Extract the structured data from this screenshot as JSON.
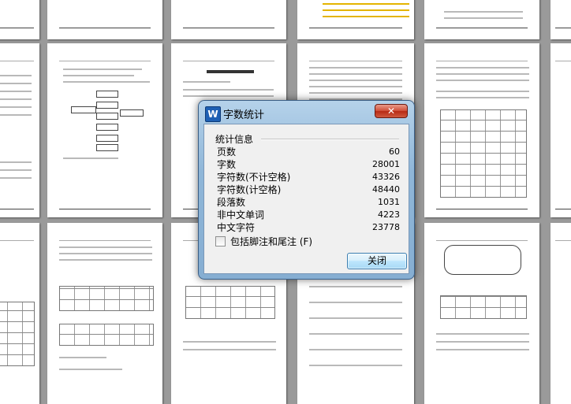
{
  "dialog": {
    "title": "字数统计",
    "app_icon_label": "W",
    "close_label": "✕",
    "section_title": "统计信息",
    "stats": [
      {
        "label": "页数",
        "value": "60"
      },
      {
        "label": "字数",
        "value": "28001"
      },
      {
        "label": "字符数(不计空格)",
        "value": "43326"
      },
      {
        "label": "字符数(计空格)",
        "value": "48440"
      },
      {
        "label": "段落数",
        "value": "1031"
      },
      {
        "label": "非中文单词",
        "value": "4223"
      },
      {
        "label": "中文字符",
        "value": "23778"
      }
    ],
    "checkbox_label": "包括脚注和尾注 (F)",
    "checkbox_checked": false,
    "ok_label": "关闭"
  }
}
